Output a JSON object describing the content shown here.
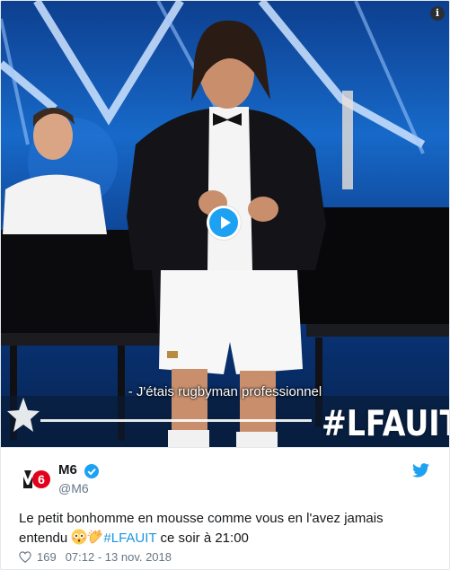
{
  "video": {
    "subtitle": "- J'étais rugbyman professionnel",
    "hashtag_overlay": "#LFAUIT",
    "info_button": "i"
  },
  "tweet": {
    "author_name": "M6",
    "author_handle": "@M6",
    "avatar_logo": "6",
    "text_part1": "Le petit bonhomme en mousse comme vous en l'avez jamais entendu ",
    "hashtag": "#LFAUIT",
    "text_part2": " ce soir à 21:00",
    "emojis": [
      "flushed-face",
      "clapping-hands"
    ],
    "likes": "169",
    "time": "07:12 - 13 nov. 2018"
  },
  "colors": {
    "twitter_blue": "#1da1f2",
    "link_blue": "#1b95e0",
    "muted_gray": "#657786",
    "text_dark": "#14171a"
  }
}
